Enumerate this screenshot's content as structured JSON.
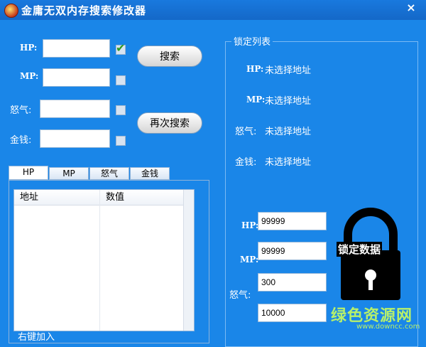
{
  "window": {
    "title": "金庸无双内存搜索修改器",
    "close_glyph": "×"
  },
  "search": {
    "fields": [
      {
        "label": "HP:",
        "value": "",
        "checked": true
      },
      {
        "label": "MP:",
        "value": "",
        "checked": false
      },
      {
        "label": "怒气:",
        "value": "",
        "checked": false
      },
      {
        "label": "金钱:",
        "value": "",
        "checked": false
      }
    ],
    "search_button": "搜索",
    "research_button": "再次搜索"
  },
  "tabs": [
    "HP",
    "MP",
    "怒气",
    "金钱"
  ],
  "results": {
    "columns": [
      "地址",
      "数值"
    ],
    "rows": []
  },
  "hint": "右键加入",
  "lock_list": {
    "title": "锁定列表",
    "items": [
      {
        "label": "HP:",
        "status": "未选择地址"
      },
      {
        "label": "MP:",
        "status": "未选择地址"
      },
      {
        "label": "怒气:",
        "status": "未选择地址"
      },
      {
        "label": "金钱:",
        "status": "未选择地址"
      }
    ],
    "inputs": [
      {
        "label": "HP:",
        "value": "99999"
      },
      {
        "label": "MP:",
        "value": "99999"
      },
      {
        "label": "怒气:",
        "value": "300"
      },
      {
        "label": "",
        "value": "10000"
      }
    ],
    "lock_button_label": "锁定数据"
  },
  "watermark": {
    "text": "绿色资源网",
    "url": "www.downcc.com"
  },
  "colors": {
    "background": "#1a86e8",
    "checkmark": "#2f9a23",
    "watermark": "#b7f06b"
  }
}
